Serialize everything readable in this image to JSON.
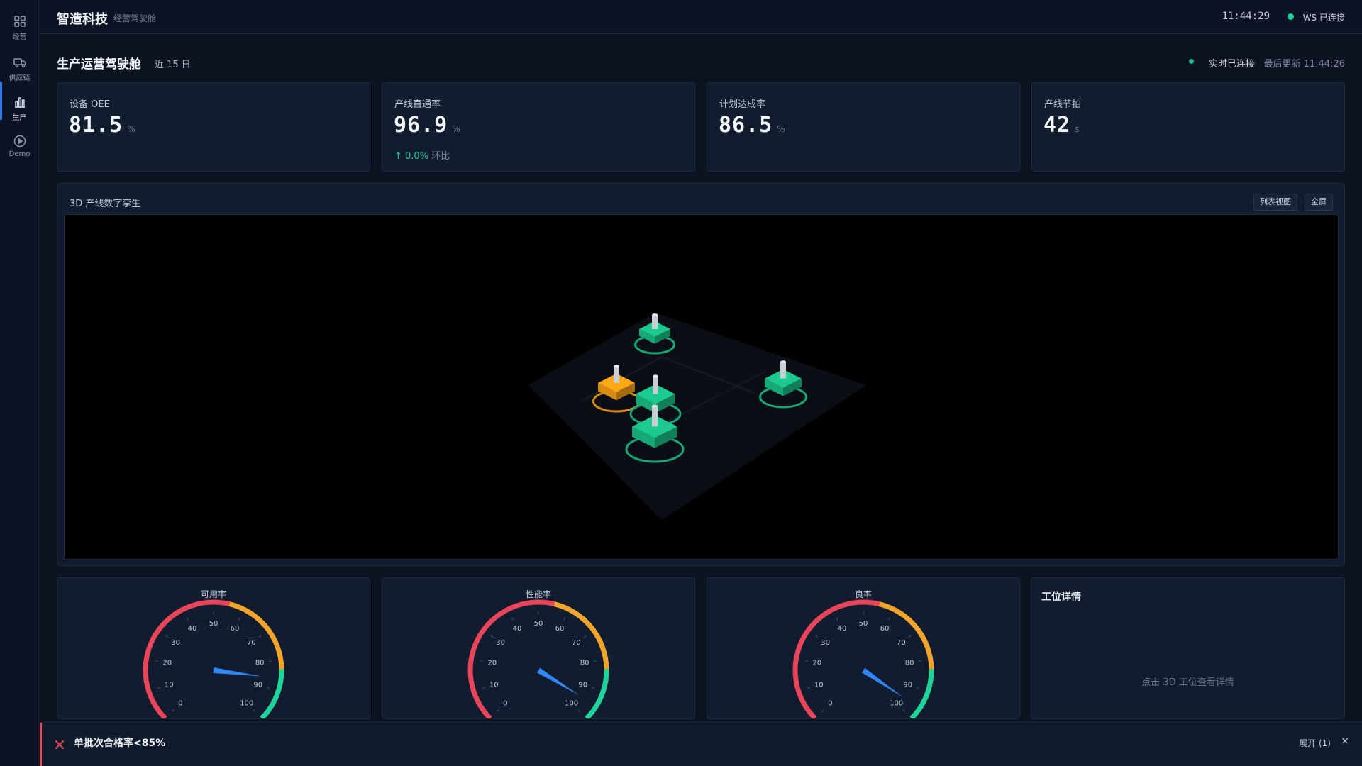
{
  "sidebar": {
    "items": [
      {
        "label": "经营",
        "icon": "grid-icon"
      },
      {
        "label": "供应链",
        "icon": "truck-icon"
      },
      {
        "label": "生产",
        "icon": "bar-chart-icon"
      },
      {
        "label": "Demo",
        "icon": "play-circle-icon"
      }
    ],
    "active": "生产"
  },
  "header": {
    "brand": "智造科技",
    "brand_sub": "经营驾驶舱",
    "clock": "11:44:29",
    "ws_status": "WS 已连接"
  },
  "page": {
    "title": "生产运营驾驶舱",
    "range": "近 15 日",
    "realtime": "实时已连接",
    "last_update": "最后更新 11:44:26"
  },
  "kpis": [
    {
      "label": "设备 OEE",
      "value": "81.5",
      "unit": "%"
    },
    {
      "label": "产线直通率",
      "value": "96.9",
      "unit": "%",
      "delta": "↑ 0.0%",
      "delta_sub": "环比"
    },
    {
      "label": "计划达成率",
      "value": "86.5",
      "unit": "%"
    },
    {
      "label": "产线节拍",
      "value": "42",
      "unit": "s"
    }
  ],
  "twin": {
    "title": "3D 产线数字孪生",
    "list_view": "列表视图",
    "fullscreen": "全屏",
    "stations": [
      {
        "status": "warning",
        "color": "#d98c12"
      },
      {
        "status": "normal",
        "color": "#17a877"
      },
      {
        "status": "normal",
        "color": "#17a877"
      },
      {
        "status": "normal",
        "color": "#17a877"
      },
      {
        "status": "normal",
        "color": "#17a877"
      }
    ]
  },
  "gauges": [
    {
      "title": "可用率",
      "value": 86
    },
    {
      "title": "性能率",
      "value": 95
    },
    {
      "title": "良率",
      "value": 96
    }
  ],
  "gauge_scale": {
    "ticks": [
      "0",
      "10",
      "20",
      "30",
      "40",
      "50",
      "60",
      "70",
      "80",
      "90",
      "100"
    ],
    "colors": {
      "low": "#e8445a",
      "mid": "#f2a52a",
      "high": "#1fd49a",
      "pointer": "#2f86f6"
    }
  },
  "detail": {
    "title": "工位详情",
    "hint": "点击 3D 工位查看详情"
  },
  "alert": {
    "text": "单批次合格率<85%",
    "expand": "展开 (1)",
    "close": "×"
  }
}
